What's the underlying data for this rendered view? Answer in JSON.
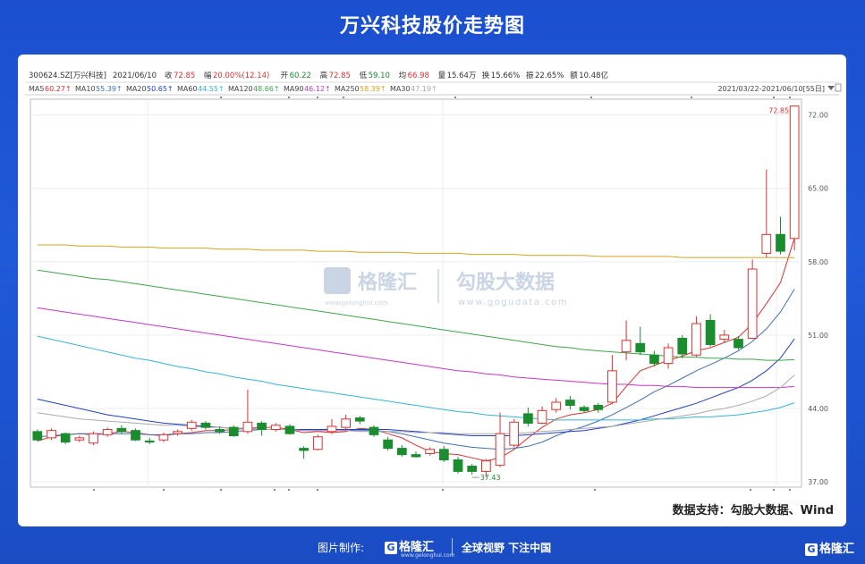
{
  "title": "万兴科技股价走势图",
  "info_line": {
    "code": "300624.SZ[万兴科技]",
    "date": "2021/06/10",
    "items": [
      {
        "label": "收",
        "value": "72.85",
        "color": "#e0302f"
      },
      {
        "label": "幅",
        "value": "20.00%(12.14)",
        "color": "#e0302f"
      },
      {
        "label": "开",
        "value": "60.22",
        "color": "#1a8d2e"
      },
      {
        "label": "高",
        "value": "72.85",
        "color": "#e0302f"
      },
      {
        "label": "低",
        "value": "59.10",
        "color": "#1a8d2e"
      },
      {
        "label": "均",
        "value": "66.98",
        "color": "#e0302f"
      },
      {
        "label": "量",
        "value": "15.64万",
        "color": "#333333"
      },
      {
        "label": "换",
        "value": "15.66%",
        "color": "#333333"
      },
      {
        "label": "振",
        "value": "22.65%",
        "color": "#333333"
      },
      {
        "label": "额",
        "value": "10.48亿",
        "color": "#333333"
      }
    ]
  },
  "ma_legend": [
    {
      "name": "MA5",
      "value": "60.27",
      "arrow": "↑",
      "color": "#e0302f"
    },
    {
      "name": "MA10",
      "value": "55.39",
      "arrow": "↑",
      "color": "#3c6fbf"
    },
    {
      "name": "MA20",
      "value": "50.65",
      "arrow": "↑",
      "color": "#1f3fcf"
    },
    {
      "name": "MA60",
      "value": "44.55",
      "arrow": "↑",
      "color": "#2fb7d9"
    },
    {
      "name": "MA120",
      "value": "48.66",
      "arrow": "↑",
      "color": "#3aa94a"
    },
    {
      "name": "MA90",
      "value": "46.12",
      "arrow": "↑",
      "color": "#cc33cc"
    },
    {
      "name": "MA250",
      "value": "58.39",
      "arrow": "↑",
      "color": "#d9a21b"
    },
    {
      "name": "MA30",
      "value": "47.19",
      "arrow": "↑",
      "color": "#aaaaaa"
    }
  ],
  "date_range": "2021/03/22-2021/06/10[55日]",
  "watermark": {
    "brand1": "格隆汇",
    "brand1_url": "www.gelonghui.com",
    "brand2": "勾股大数据",
    "brand2_url": "www.gogudata.com"
  },
  "source": "数据支持：勾股大数据、Wind",
  "footer": {
    "credit": "图片制作:",
    "brand": "格隆汇",
    "brand_url": "www.gelonghui.com",
    "slogan": "全球视野 下注中国",
    "brand_right": "格隆汇"
  },
  "colors": {
    "up": "#e0302f",
    "down": "#1a8d2e",
    "accent": "#1b4fd0"
  },
  "chart_data": {
    "type": "candlestick",
    "y_ticks": [
      "72.00",
      "65.00",
      "58.00",
      "51.00",
      "44.00",
      "37.00"
    ],
    "ylim": [
      36.5,
      73.5
    ],
    "grid": true,
    "annotations": [
      {
        "text": "72.85",
        "index": 54,
        "value": 72.85
      },
      {
        "text": "37.43",
        "index": 31,
        "value": 37.43
      }
    ],
    "candles": [
      [
        41.8,
        41.0,
        42.0,
        40.9
      ],
      [
        41.2,
        41.9,
        42.1,
        41.0
      ],
      [
        41.6,
        40.8,
        41.7,
        40.6
      ],
      [
        41.0,
        41.2,
        41.4,
        40.8
      ],
      [
        40.7,
        41.6,
        41.8,
        40.5
      ],
      [
        41.5,
        42.0,
        42.2,
        41.3
      ],
      [
        42.1,
        41.8,
        42.4,
        41.6
      ],
      [
        41.9,
        41.0,
        42.1,
        40.9
      ],
      [
        40.9,
        40.8,
        41.2,
        40.6
      ],
      [
        41.0,
        41.5,
        41.7,
        40.8
      ],
      [
        41.6,
        41.8,
        42.0,
        41.4
      ],
      [
        42.1,
        42.7,
        42.9,
        41.9
      ],
      [
        42.6,
        42.2,
        42.8,
        42.0
      ],
      [
        42.0,
        41.8,
        42.3,
        41.6
      ],
      [
        42.2,
        41.4,
        42.4,
        41.3
      ],
      [
        41.8,
        42.7,
        45.8,
        41.6
      ],
      [
        42.6,
        42.0,
        42.8,
        41.4
      ],
      [
        42.0,
        42.4,
        42.6,
        41.8
      ],
      [
        42.3,
        41.6,
        42.5,
        41.5
      ],
      [
        40.2,
        40.0,
        40.4,
        39.2
      ],
      [
        40.1,
        41.3,
        41.5,
        40.0
      ],
      [
        41.8,
        42.3,
        43.0,
        41.6
      ],
      [
        42.2,
        43.0,
        43.4,
        41.9
      ],
      [
        43.1,
        42.8,
        43.3,
        42.5
      ],
      [
        42.2,
        41.5,
        42.4,
        41.3
      ],
      [
        41.0,
        40.2,
        41.3,
        40.0
      ],
      [
        40.2,
        39.6,
        40.5,
        39.4
      ],
      [
        39.6,
        39.4,
        39.9,
        39.3
      ],
      [
        39.7,
        40.1,
        40.3,
        39.5
      ],
      [
        40.1,
        39.1,
        40.4,
        38.9
      ],
      [
        39.1,
        38.0,
        39.4,
        37.8
      ],
      [
        38.5,
        38.0,
        38.7,
        37.7
      ],
      [
        38.0,
        39.0,
        39.2,
        37.43
      ],
      [
        38.6,
        41.6,
        43.6,
        38.4
      ],
      [
        40.5,
        42.7,
        43.0,
        40.3
      ],
      [
        43.5,
        42.6,
        44.1,
        42.3
      ],
      [
        42.6,
        43.8,
        44.2,
        42.5
      ],
      [
        43.9,
        44.6,
        45.0,
        43.6
      ],
      [
        44.8,
        44.3,
        45.2,
        43.9
      ],
      [
        44.1,
        43.8,
        44.3,
        43.6
      ],
      [
        44.3,
        43.9,
        44.5,
        43.6
      ],
      [
        44.6,
        47.6,
        49.1,
        44.4
      ],
      [
        49.4,
        50.5,
        52.4,
        48.6
      ],
      [
        50.2,
        49.4,
        51.8,
        49.1
      ],
      [
        49.1,
        48.3,
        49.5,
        48.0
      ],
      [
        48.3,
        49.8,
        50.2,
        47.8
      ],
      [
        50.7,
        49.2,
        51.0,
        48.8
      ],
      [
        49.1,
        52.1,
        52.8,
        48.9
      ],
      [
        52.4,
        50.1,
        53.0,
        49.9
      ],
      [
        50.6,
        51.0,
        51.5,
        50.3
      ],
      [
        50.6,
        49.8,
        50.9,
        49.6
      ],
      [
        50.7,
        57.3,
        58.2,
        50.6
      ],
      [
        58.8,
        60.6,
        66.8,
        58.4
      ],
      [
        60.6,
        59.0,
        62.3,
        58.7
      ],
      [
        60.22,
        72.85,
        72.85,
        59.1
      ]
    ],
    "ma": {
      "MA5": [
        40.9,
        41.3,
        41.5,
        41.6,
        41.5,
        41.6,
        41.8,
        41.7,
        41.5,
        41.4,
        41.6,
        41.7,
        41.9,
        41.9,
        42.0,
        42.1,
        42.2,
        42.2,
        42.0,
        41.7,
        41.8,
        41.7,
        41.8,
        42.1,
        42.0,
        41.6,
        41.2,
        40.5,
        39.9,
        39.7,
        39.6,
        39.3,
        39.0,
        39.3,
        40.1,
        41.2,
        42.2,
        43.0,
        43.4,
        43.6,
        43.9,
        44.5,
        46.1,
        47.6,
        48.1,
        48.6,
        49.0,
        49.5,
        49.8,
        50.3,
        50.8,
        52.1,
        54.0,
        56.0,
        60.27
      ],
      "MA10": [
        41.3,
        41.4,
        41.5,
        41.6,
        41.6,
        41.6,
        41.6,
        41.6,
        41.5,
        41.5,
        41.6,
        41.6,
        41.7,
        41.7,
        41.8,
        41.9,
        42.0,
        42.0,
        42.0,
        41.9,
        41.9,
        41.9,
        41.9,
        41.9,
        41.9,
        41.8,
        41.6,
        41.3,
        41.0,
        40.7,
        40.5,
        40.3,
        40.2,
        40.1,
        40.2,
        40.4,
        40.8,
        41.4,
        41.9,
        42.3,
        42.8,
        43.4,
        44.1,
        44.8,
        45.6,
        46.2,
        46.9,
        47.6,
        48.2,
        48.8,
        49.5,
        50.4,
        51.6,
        53.2,
        55.39
      ],
      "MA20": [
        44.9,
        44.6,
        44.3,
        44.0,
        43.7,
        43.4,
        43.2,
        43.0,
        42.8,
        42.6,
        42.5,
        42.4,
        42.3,
        42.2,
        42.1,
        42.1,
        42.0,
        42.0,
        42.0,
        42.0,
        42.0,
        42.0,
        42.0,
        42.0,
        42.0,
        42.0,
        41.9,
        41.8,
        41.7,
        41.6,
        41.5,
        41.4,
        41.4,
        41.4,
        41.4,
        41.5,
        41.6,
        41.7,
        41.8,
        41.9,
        42.1,
        42.3,
        42.6,
        42.9,
        43.3,
        43.7,
        44.1,
        44.5,
        45.0,
        45.5,
        46.0,
        46.7,
        47.6,
        48.8,
        50.65
      ],
      "MA30": [
        43.6,
        43.4,
        43.2,
        43.0,
        42.9,
        42.8,
        42.7,
        42.6,
        42.5,
        42.4,
        42.4,
        42.3,
        42.2,
        42.2,
        42.1,
        42.1,
        42.0,
        42.0,
        42.0,
        41.9,
        41.9,
        41.9,
        41.9,
        41.8,
        41.8,
        41.8,
        41.8,
        41.7,
        41.7,
        41.7,
        41.6,
        41.6,
        41.6,
        41.6,
        41.6,
        41.7,
        41.8,
        41.9,
        42.0,
        42.1,
        42.2,
        42.3,
        42.5,
        42.7,
        42.9,
        43.1,
        43.3,
        43.5,
        43.8,
        44.0,
        44.3,
        44.7,
        45.2,
        46.0,
        47.19
      ],
      "MA60": [
        50.9,
        50.6,
        50.3,
        50.0,
        49.7,
        49.4,
        49.1,
        48.8,
        48.6,
        48.3,
        48.0,
        47.8,
        47.5,
        47.3,
        47.0,
        46.8,
        46.6,
        46.3,
        46.1,
        45.9,
        45.7,
        45.5,
        45.3,
        45.1,
        44.9,
        44.7,
        44.5,
        44.3,
        44.1,
        43.9,
        43.7,
        43.6,
        43.4,
        43.3,
        43.2,
        43.1,
        43.0,
        42.9,
        42.9,
        42.9,
        42.9,
        42.9,
        42.9,
        42.9,
        43.0,
        43.0,
        43.1,
        43.2,
        43.2,
        43.3,
        43.4,
        43.6,
        43.8,
        44.1,
        44.55
      ],
      "MA90": [
        53.6,
        53.4,
        53.2,
        53.0,
        52.8,
        52.6,
        52.4,
        52.2,
        52.0,
        51.8,
        51.6,
        51.4,
        51.2,
        51.0,
        50.8,
        50.6,
        50.4,
        50.2,
        50.0,
        49.8,
        49.6,
        49.4,
        49.2,
        49.0,
        48.8,
        48.6,
        48.4,
        48.2,
        48.0,
        47.8,
        47.6,
        47.5,
        47.3,
        47.2,
        47.0,
        46.9,
        46.8,
        46.7,
        46.6,
        46.5,
        46.4,
        46.3,
        46.3,
        46.2,
        46.2,
        46.1,
        46.1,
        46.0,
        46.0,
        46.0,
        46.0,
        46.0,
        46.0,
        46.0,
        46.12
      ],
      "MA120": [
        57.2,
        57.0,
        56.8,
        56.6,
        56.4,
        56.3,
        56.1,
        55.9,
        55.7,
        55.5,
        55.3,
        55.1,
        54.9,
        54.7,
        54.5,
        54.3,
        54.1,
        53.9,
        53.7,
        53.5,
        53.3,
        53.1,
        52.9,
        52.7,
        52.5,
        52.3,
        52.1,
        51.9,
        51.7,
        51.5,
        51.3,
        51.1,
        50.9,
        50.7,
        50.5,
        50.3,
        50.1,
        49.9,
        49.8,
        49.6,
        49.5,
        49.4,
        49.3,
        49.2,
        49.1,
        49.0,
        48.9,
        48.9,
        48.8,
        48.8,
        48.7,
        48.7,
        48.6,
        48.6,
        48.66
      ],
      "MA250": [
        59.6,
        59.6,
        59.6,
        59.5,
        59.5,
        59.5,
        59.4,
        59.4,
        59.4,
        59.3,
        59.3,
        59.3,
        59.3,
        59.2,
        59.2,
        59.2,
        59.1,
        59.1,
        59.1,
        59.1,
        59.0,
        59.0,
        59.0,
        58.9,
        58.9,
        58.9,
        58.9,
        58.8,
        58.8,
        58.8,
        58.8,
        58.7,
        58.7,
        58.7,
        58.7,
        58.6,
        58.6,
        58.6,
        58.6,
        58.6,
        58.5,
        58.5,
        58.5,
        58.5,
        58.5,
        58.5,
        58.4,
        58.4,
        58.4,
        58.4,
        58.4,
        58.4,
        58.4,
        58.4,
        58.39
      ]
    }
  }
}
